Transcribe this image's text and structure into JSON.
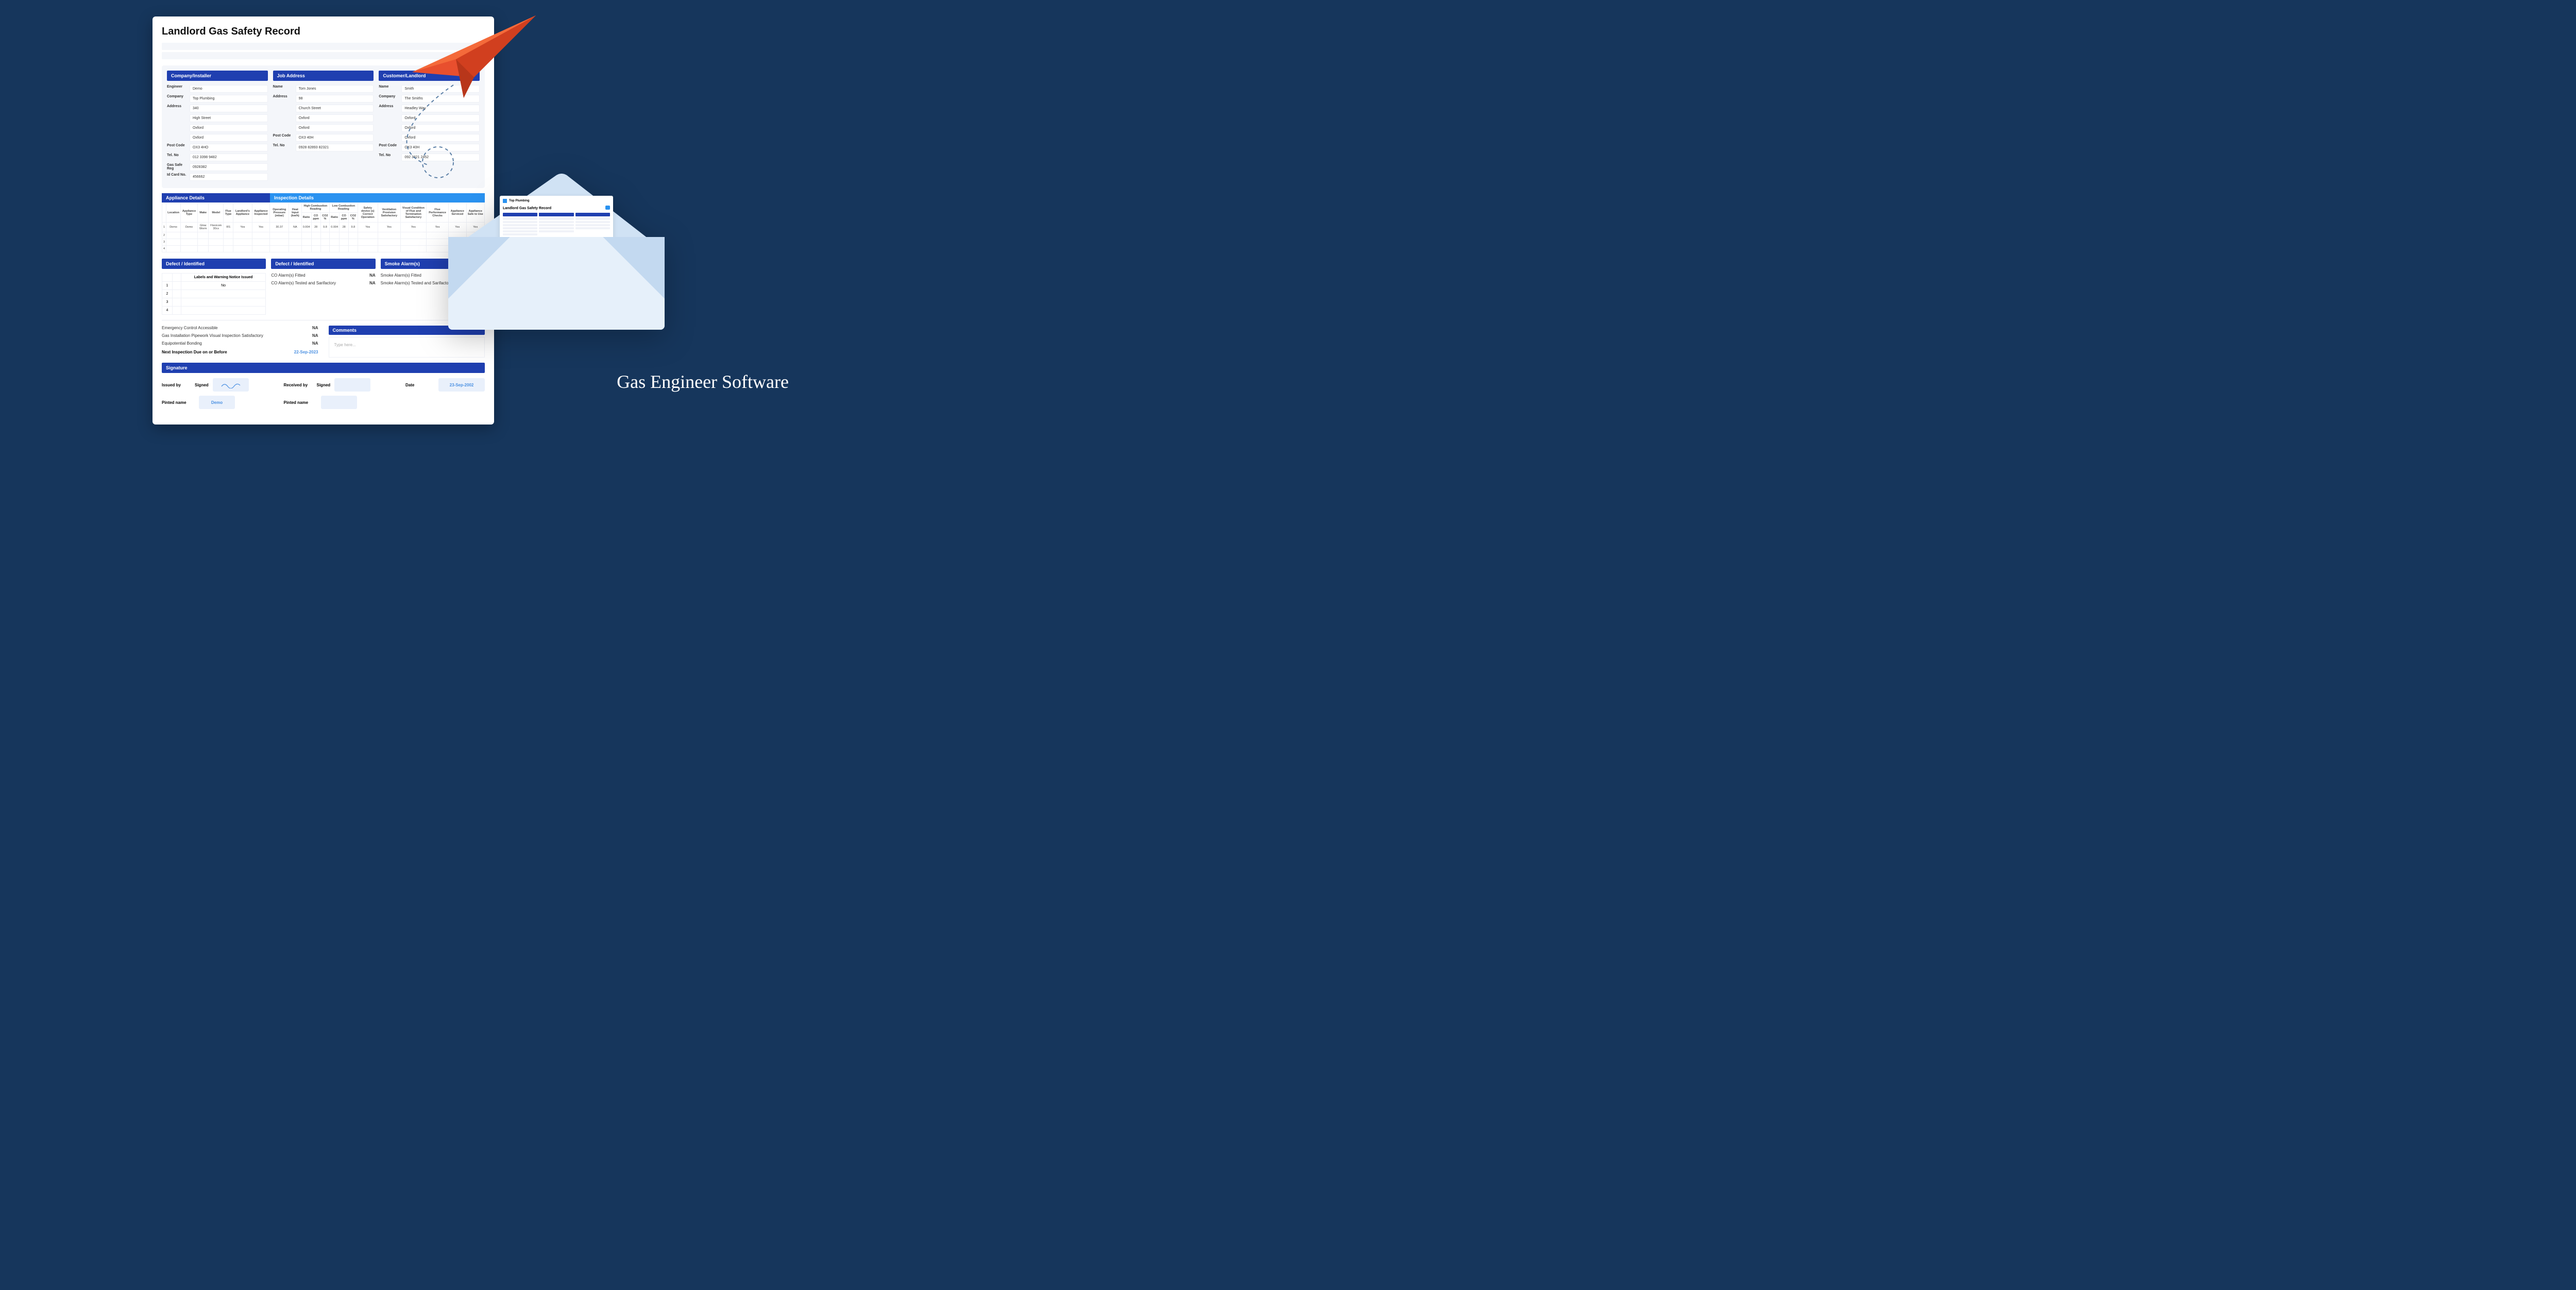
{
  "title": "Landlord Gas Safety Record",
  "sections": {
    "company": {
      "header": "Company/Installer"
    },
    "job": {
      "header": "Job Address"
    },
    "customer": {
      "header": "Customer/Landlord"
    }
  },
  "company": {
    "engineer_k": "Engineer",
    "engineer": "Demo",
    "company_k": "Company",
    "company": "Top Plumbing",
    "address_k": "Address",
    "a1": "340",
    "a2": "High Street",
    "a3": "Oxford",
    "a4": "Oxford",
    "postcode_k": "Post Code",
    "postcode": "OX3 4HO",
    "tel_k": "Tel. No",
    "tel": "012 3398 9482",
    "gsr_k": "Gas Safe Reg",
    "gsr": "0928382",
    "id_k": "Id Card No.",
    "id": "456662"
  },
  "job": {
    "name_k": "Name",
    "name": "Tom Jones",
    "address_k": "Address",
    "a1": "98",
    "a2": "Church Street",
    "a3": "Oxford",
    "a4": "Oxford",
    "postcode_k": "Post Code",
    "postcode": "OX3 40H",
    "tel_k": "Tel. No",
    "tel": "0928 82893 82321"
  },
  "customer": {
    "name_k": "Name",
    "name": "Smith",
    "company_k": "Company",
    "company": "The Smiths",
    "address_k": "Address",
    "a1": "Headley Way",
    "a2": "Oxford",
    "a3": "Oxford",
    "a4": "Oxford",
    "postcode_k": "Post Code",
    "postcode": "OX3 40H",
    "tel_k": "Tel. No",
    "tel": "092 3321 2452"
  },
  "appl_h": "Appliance Details",
  "insp_h": "Inspection Details",
  "cols": {
    "n": "",
    "loc": "Location",
    "atype": "Appliance Type",
    "make": "Make",
    "model": "Model",
    "ftype": "Flue Type",
    "land": "Landlord's Appliance",
    "ainsp": "Appliance Inspected",
    "op": "Operating Pressure (mbar)",
    "heat": "Heat Input (kw/h)",
    "high": "High Combustion Reading",
    "low": "Low Combustion Reading",
    "ratio": "Ratio",
    "coppm": "CO ppm",
    "co2": "CO2 %",
    "sdev": "Safety device (s) Correct Operation",
    "vent": "Ventilation Provision Satisfactory",
    "flue": "Visual Condition of Flue and Termination Satisfactory",
    "ftest": "Flue Performance Checks",
    "serv": "Appliance Serviced",
    "safe": "Appliance Safe to Use"
  },
  "rows": [
    {
      "n": "1",
      "loc": "Demo",
      "atype": "Demo",
      "make": "Glow Worm",
      "model": "Flexicom 30cx",
      "ftype": "RS",
      "land": "Yes",
      "ainsp": "Yes",
      "op": "30.37",
      "heat": "NA",
      "hr": "0.004",
      "hco": "28",
      "hco2": "9.8",
      "lr": "0.004",
      "lco": "28",
      "lco2": "9.8",
      "sdev": "Yes",
      "vent": "Yes",
      "flue": "Yes",
      "ftest": "Yes",
      "serv": "Yes",
      "safe": "Yes"
    },
    {
      "n": "2"
    },
    {
      "n": "3"
    },
    {
      "n": "4"
    }
  ],
  "defect_h": "Defect / Identified",
  "defect_cap": "Labels and Warning Notice Issued",
  "defect_rows": [
    {
      "n": "1",
      "v": "No"
    },
    {
      "n": "2",
      "v": ""
    },
    {
      "n": "3",
      "v": ""
    },
    {
      "n": "4",
      "v": ""
    }
  ],
  "co": {
    "fit": "CO Alarm(s) Fitted",
    "fit_v": "NA",
    "test": "CO Alarm(s) Tested and Sarifactory",
    "test_v": "NA"
  },
  "smoke_h": "Smoke Alarm(s)",
  "smoke": {
    "fit": "Smoke Alarm(s) Fitted",
    "test": "Smoke Alarm(s) Tested and Sarifactory"
  },
  "checks": {
    "c1": "Emergency Control Accessible",
    "v1": "NA",
    "c2": "Gas Installation Pipework Visual Inspection Satisfactory",
    "v2": "NA",
    "c3": "Equipotential Bonding",
    "v3": "NA",
    "next_k": "Next Inspection Due on or Before",
    "next_v": "22-Sep-2023"
  },
  "comments_h": "Comments",
  "comments_ph": "Type here...",
  "sig_h": "Signature",
  "sig": {
    "issued_k": "Issued by",
    "signed_k": "Signed",
    "received_k": "Received by",
    "pname_k": "Pinted name",
    "pname_v": "Demo",
    "date_k": "Date",
    "date_v": "23-Sep-2002"
  },
  "mini": {
    "brand": "Top Plumbing",
    "title": "Landlord Gas Safety Record"
  },
  "footer_brand": "Gas Engineer Software"
}
